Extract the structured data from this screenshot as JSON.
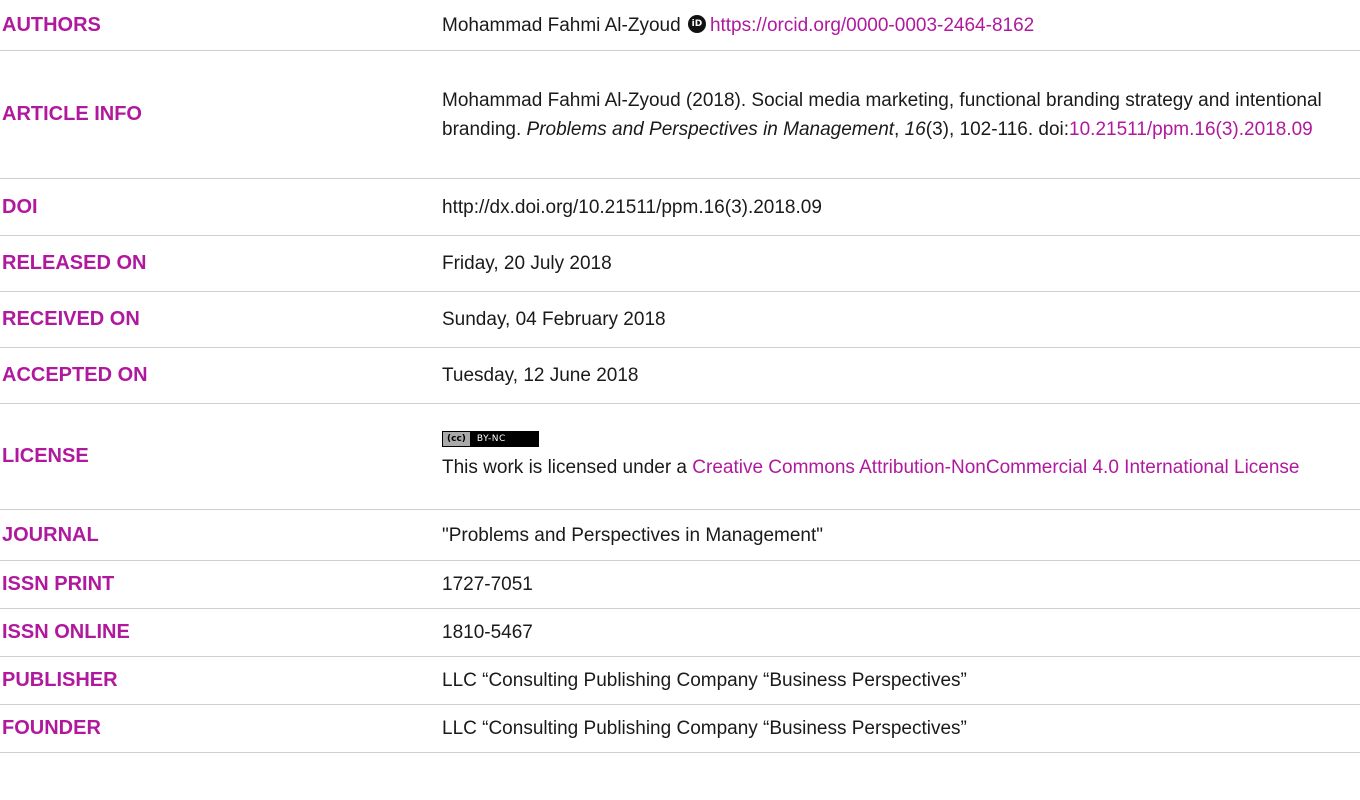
{
  "rows": {
    "authors": {
      "label": "AUTHORS",
      "name": "Mohammad Fahmi Al-Zyoud",
      "orcid_icon_text": "iD",
      "orcid_url": "https://orcid.org/0000-0003-2464-8162"
    },
    "article_info": {
      "label": "ARTICLE INFO",
      "part1": "Mohammad Fahmi Al-Zyoud (2018). Social media marketing, functional branding strategy and intentional branding. ",
      "journal_italic": "Problems and Perspectives in Management",
      "part2": ", ",
      "volume_italic": "16",
      "part3": "(3), 102-116. doi:",
      "doi_link": "10.21511/ppm.16(3).2018.09"
    },
    "doi": {
      "label": "DOI",
      "value": "http://dx.doi.org/10.21511/ppm.16(3).2018.09"
    },
    "released_on": {
      "label": "RELEASED ON",
      "value": "Friday, 20 July 2018"
    },
    "received_on": {
      "label": "RECEIVED ON",
      "value": "Sunday, 04 February 2018"
    },
    "accepted_on": {
      "label": "ACCEPTED ON",
      "value": "Tuesday, 12 June 2018"
    },
    "license": {
      "label": "LICENSE",
      "badge_left": "(cc)",
      "badge_right": "BY-NC",
      "text": "This work is licensed under a ",
      "link": "Creative Commons Attribution-NonCommercial 4.0 International License"
    },
    "journal": {
      "label": "JOURNAL",
      "value": "\"Problems and Perspectives in Management\""
    },
    "issn_print": {
      "label": "ISSN PRINT",
      "value": "1727-7051"
    },
    "issn_online": {
      "label": "ISSN ONLINE",
      "value": "1810-5467"
    },
    "publisher": {
      "label": "PUBLISHER",
      "value": "LLC “Consulting Publishing Company “Business Perspectives”"
    },
    "founder": {
      "label": "FOUNDER",
      "value": "LLC “Consulting Publishing Company “Business Perspectives”"
    }
  },
  "colors": {
    "accent": "#b0199e",
    "text": "#1a1a1a",
    "divider": "#cfcfcf"
  }
}
